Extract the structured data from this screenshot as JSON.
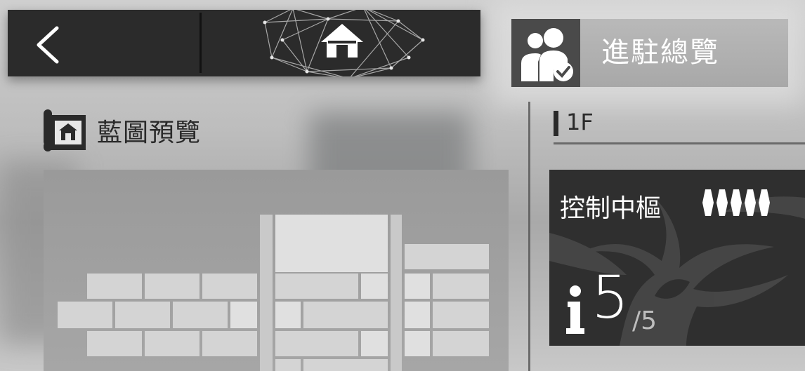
{
  "header": {
    "back_icon": "chevron-left-icon",
    "home_icon": "home-network-icon"
  },
  "overview": {
    "label": "進駐總覽",
    "icon": "users-check-icon"
  },
  "blueprint": {
    "title": "藍圖預覽",
    "icon": "blueprint-scroll-icon"
  },
  "floor": {
    "label": "1F"
  },
  "hub_card": {
    "title": "控制中樞",
    "signal_bars": 5,
    "occupants": "5",
    "capacity": "/5",
    "person_icon": "person-icon"
  },
  "colors": {
    "bar_dark": "#2b2b2b",
    "card_dark": "#2f2f2f",
    "text_dark": "#2a2a2a",
    "white": "#ffffff"
  }
}
